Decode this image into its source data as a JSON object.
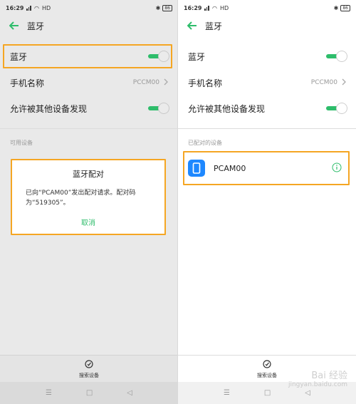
{
  "status_bar": {
    "time": "16:29",
    "network": "HD",
    "battery": "86"
  },
  "app_bar": {
    "title": "蓝牙"
  },
  "left": {
    "bluetooth_label": "蓝牙",
    "phone_name_label": "手机名称",
    "phone_name_value": "PCCM00",
    "discoverable_label": "允许被其他设备发现",
    "section_label": "可用设备",
    "dialog": {
      "title": "蓝牙配对",
      "message": "已向“PCAM00”发出配对请求。配对码为“519305”。",
      "cancel": "取消"
    },
    "scan_label": "搜索设备"
  },
  "right": {
    "bluetooth_label": "蓝牙",
    "phone_name_label": "手机名称",
    "phone_name_value": "PCCM00",
    "discoverable_label": "允许被其他设备发现",
    "section_label": "已配对的设备",
    "paired_device": "PCAM00",
    "scan_label": "搜索设备"
  },
  "watermark": {
    "line1": "Bai 经验",
    "line2": "jingyan.baidu.com"
  },
  "colors": {
    "accent": "#2ebd6b",
    "highlight": "#f5a623",
    "device_icon": "#1e88ff"
  },
  "toggles": {
    "left_bluetooth": true,
    "left_discoverable": true,
    "right_bluetooth": true,
    "right_discoverable": true
  },
  "icons": [
    "back-arrow-icon",
    "chevron-right-icon",
    "phone-icon",
    "info-icon",
    "search-scan-icon",
    "nav-menu-icon",
    "nav-home-icon",
    "nav-back-icon"
  ]
}
